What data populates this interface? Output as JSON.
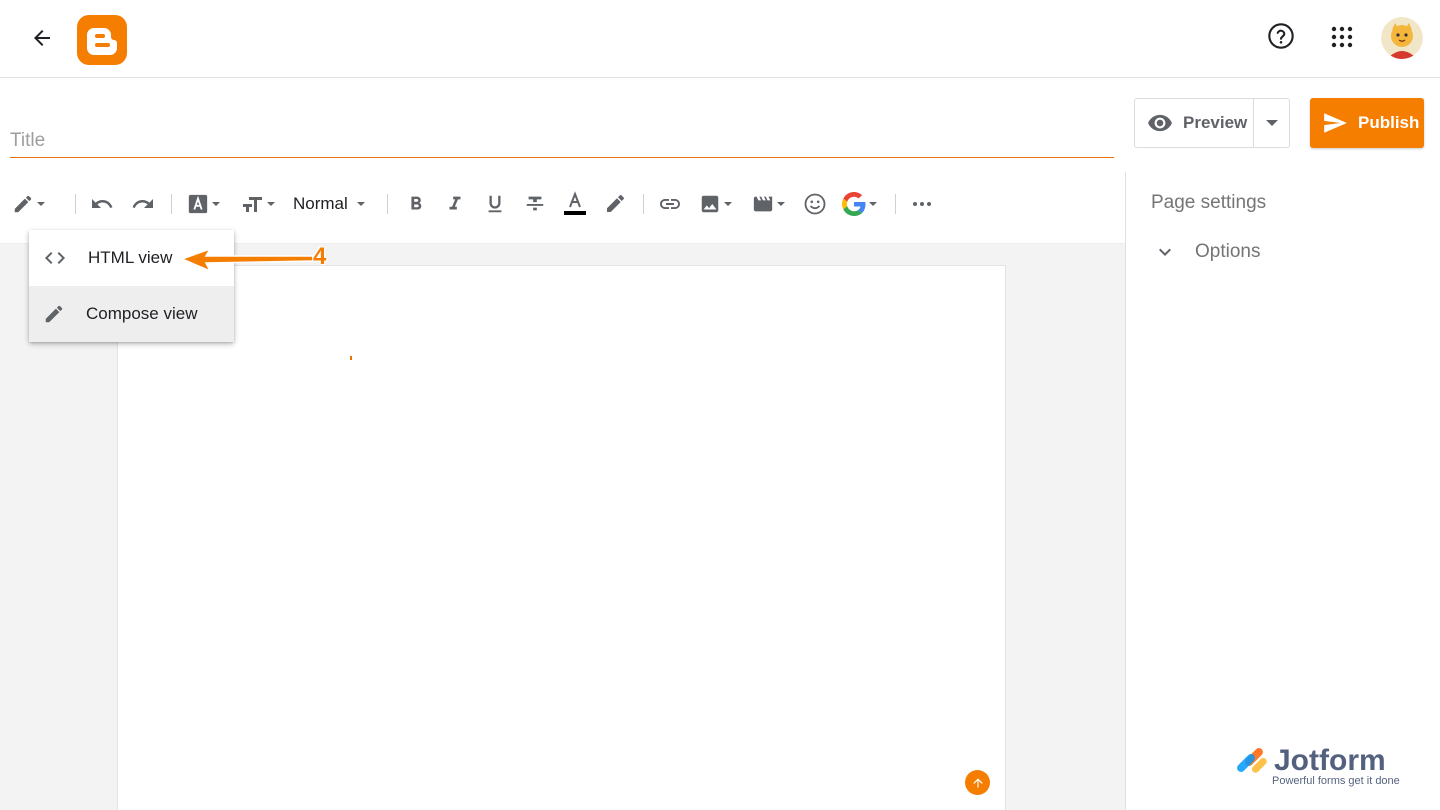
{
  "header": {
    "back_icon": "arrow-left-icon",
    "logo_icon": "blogger-logo-icon",
    "help_icon": "help-circle-icon",
    "apps_icon": "apps-grid-icon",
    "brand_color": "#f57d00"
  },
  "editor": {
    "title_placeholder": "Title",
    "title_value": ""
  },
  "actions": {
    "preview_label": "Preview",
    "publish_label": "Publish"
  },
  "toolbar": {
    "format_label": "Normal"
  },
  "view_menu": {
    "items": [
      {
        "label": "HTML view",
        "icon": "code-icon"
      },
      {
        "label": "Compose view",
        "icon": "pencil-icon"
      }
    ]
  },
  "annotation": {
    "step_number": "4",
    "color": "#f57d00"
  },
  "sidebar": {
    "page_settings_label": "Page settings",
    "options_label": "Options"
  },
  "watermark": {
    "name": "Jotform",
    "tagline": "Powerful forms get it done"
  }
}
